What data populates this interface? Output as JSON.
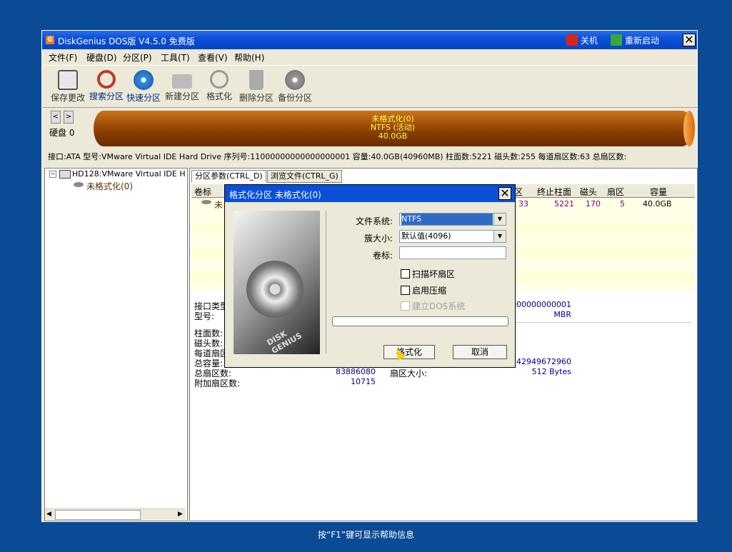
{
  "window": {
    "title": "DiskGenius DOS版 V4.5.0 免费版",
    "shutdown_label": "关机",
    "restart_label": "重新启动",
    "close_symbol": "✕"
  },
  "menu": [
    "文件(F)",
    "硬盘(D)",
    "分区(P)",
    "工具(T)",
    "查看(V)",
    "帮助(H)"
  ],
  "toolbar": [
    {
      "label": "保存更改",
      "icon": "save-icon"
    },
    {
      "label": "搜索分区",
      "icon": "search-icon"
    },
    {
      "label": "快速分区",
      "icon": "quick-partition-icon"
    },
    {
      "label": "新建分区",
      "icon": "new-partition-icon"
    },
    {
      "label": "格式化",
      "icon": "format-icon"
    },
    {
      "label": "删除分区",
      "icon": "delete-icon"
    },
    {
      "label": "备份分区",
      "icon": "backup-icon"
    }
  ],
  "disk": {
    "label": "硬盘 0",
    "bar_line1": "未格式化(0)",
    "bar_line2": "NTFS (活动)",
    "bar_line3": "40.0GB",
    "info_line": "接口:ATA  型号:VMware Virtual IDE Hard Drive  序列号:11000000000000000001  容量:40.0GB(40960MB)  柱面数:5221  磁头数:255  每道扇区数:63  总扇区数:"
  },
  "tree": {
    "disk_item": "HD128:VMware Virtual IDE H",
    "partition_item": "未格式化(0)"
  },
  "tabs": [
    "分区参数(CTRL_D)",
    "浏览文件(CTRL_G)"
  ],
  "table": {
    "headers": [
      "卷标",
      "区",
      "终止柱面",
      "磁头",
      "扇区",
      "容量"
    ],
    "row": {
      "label": "未",
      "c1": "33",
      "end_cyl": "5221",
      "head": "170",
      "sector": "5",
      "size": "40.0GB"
    }
  },
  "info": {
    "iface_label": "接口类型",
    "model_label": "型号:",
    "serial_partial": "0000000000001",
    "mbr": "MBR",
    "cyl_label": "柱面数:",
    "head_label": "磁头数:",
    "spt_label": "每道扇区",
    "cap_label": "总容量:",
    "total_sec_label": "总扇区数:",
    "total_sec_val": "83886080",
    "extra_label": "附加扇区数:",
    "extra_val": "10715",
    "bytes_val": "42949672960",
    "sector_size_label": "扇区大小:",
    "sector_size_val": "512 Bytes"
  },
  "dialog": {
    "title": "格式化分区 未格式化(0)",
    "fs_label": "文件系统:",
    "fs_value": "NTFS",
    "cluster_label": "簇大小:",
    "cluster_value": "默认值(4096)",
    "volume_label": "卷标:",
    "volume_value": "",
    "scan_bad": "扫描坏扇区",
    "compress": "启用压缩",
    "dos_system": "建立DOS系统",
    "format_btn": "格式化",
    "cancel_btn": "取消",
    "image_text": "DISK GENIUS"
  },
  "footer": "按“F1”键可显示帮助信息",
  "colors": {
    "desktop": "#0b4a94",
    "accent": "#0a4fd8",
    "disk_bar": "#8a3d00",
    "disk_text": "#ffff40"
  }
}
